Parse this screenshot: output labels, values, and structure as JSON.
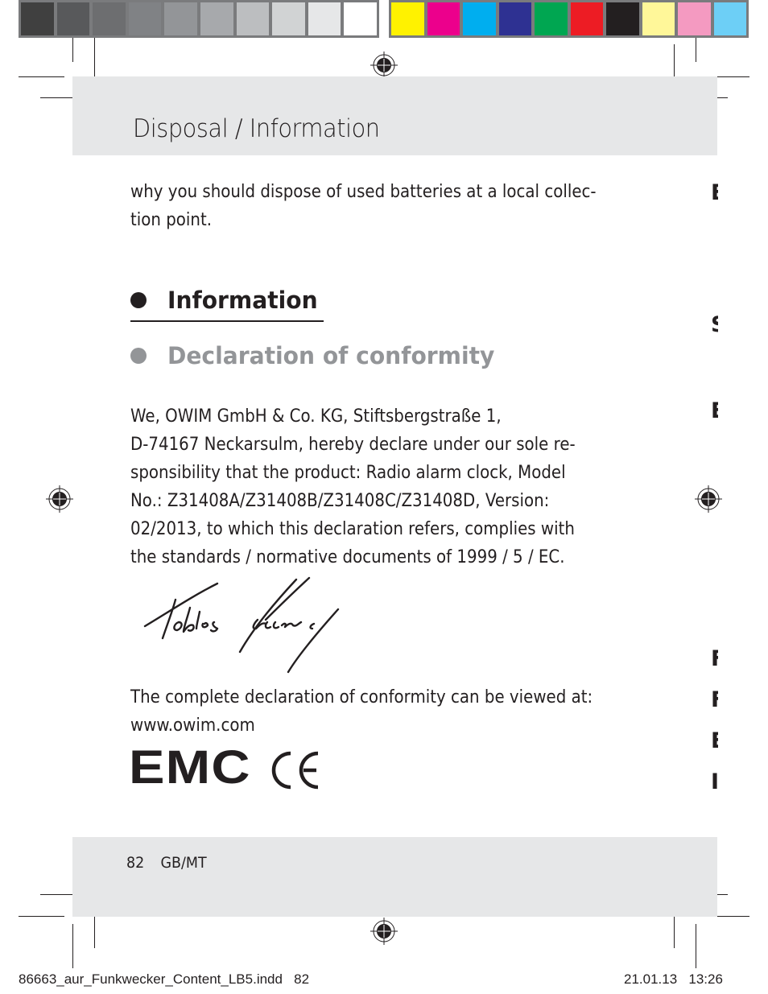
{
  "color_bars": {
    "grayscale": [
      "#404040",
      "#58595b",
      "#6d6e70",
      "#808285",
      "#939598",
      "#a7a9ac",
      "#bcbec0",
      "#d1d3d4",
      "#e6e7e8",
      "#ffffff"
    ],
    "process": [
      "#fff200",
      "#ec008c",
      "#00aeef",
      "#2e3192",
      "#00a651",
      "#ed1c24",
      "#231f20",
      "#fff799",
      "#f49ac1",
      "#6dcff6"
    ]
  },
  "header": {
    "title": "Disposal / Information"
  },
  "intro_text": {
    "lines": [
      "why you should dispose of used batteries at a local collec-",
      "tion point."
    ]
  },
  "sections": [
    {
      "label": "Information",
      "state": "active"
    },
    {
      "label": "Declaration of conformity",
      "state": "inactive"
    }
  ],
  "declaration": {
    "lines": [
      "We, OWIM GmbH & Co. KG, Stiftsbergstraße 1,",
      "D-74167 Neckarsulm, hereby declare under our sole re-",
      "sponsibility that the product: Radio alarm clock, Model",
      "No.: Z31408A/Z31408B/Z31408C/Z31408D, Version:",
      "02/2013, to which this declaration refers, complies with",
      "the standards / normative documents of 1999 / 5 / EC."
    ],
    "signature_icon": "handwritten-signature"
  },
  "full_declaration": {
    "lines": [
      "The complete declaration of conformity can be viewed at:",
      "www.owim.com"
    ]
  },
  "marks": {
    "emc": "EMC",
    "ce_icon": "ce-mark"
  },
  "right_margin_letters": [
    "E",
    "S",
    "E",
    "F",
    "F",
    "E",
    "I"
  ],
  "footer": {
    "page_number": "82",
    "language": "GB/MT"
  },
  "slug": {
    "file": "86663_aur_Funkwecker_Content_LB5.indd   82",
    "date": "21.01.13",
    "time": "13:26"
  },
  "colors": {
    "text": "#231f20",
    "band": "#e6e7e8",
    "inactive_heading": "#939598"
  }
}
